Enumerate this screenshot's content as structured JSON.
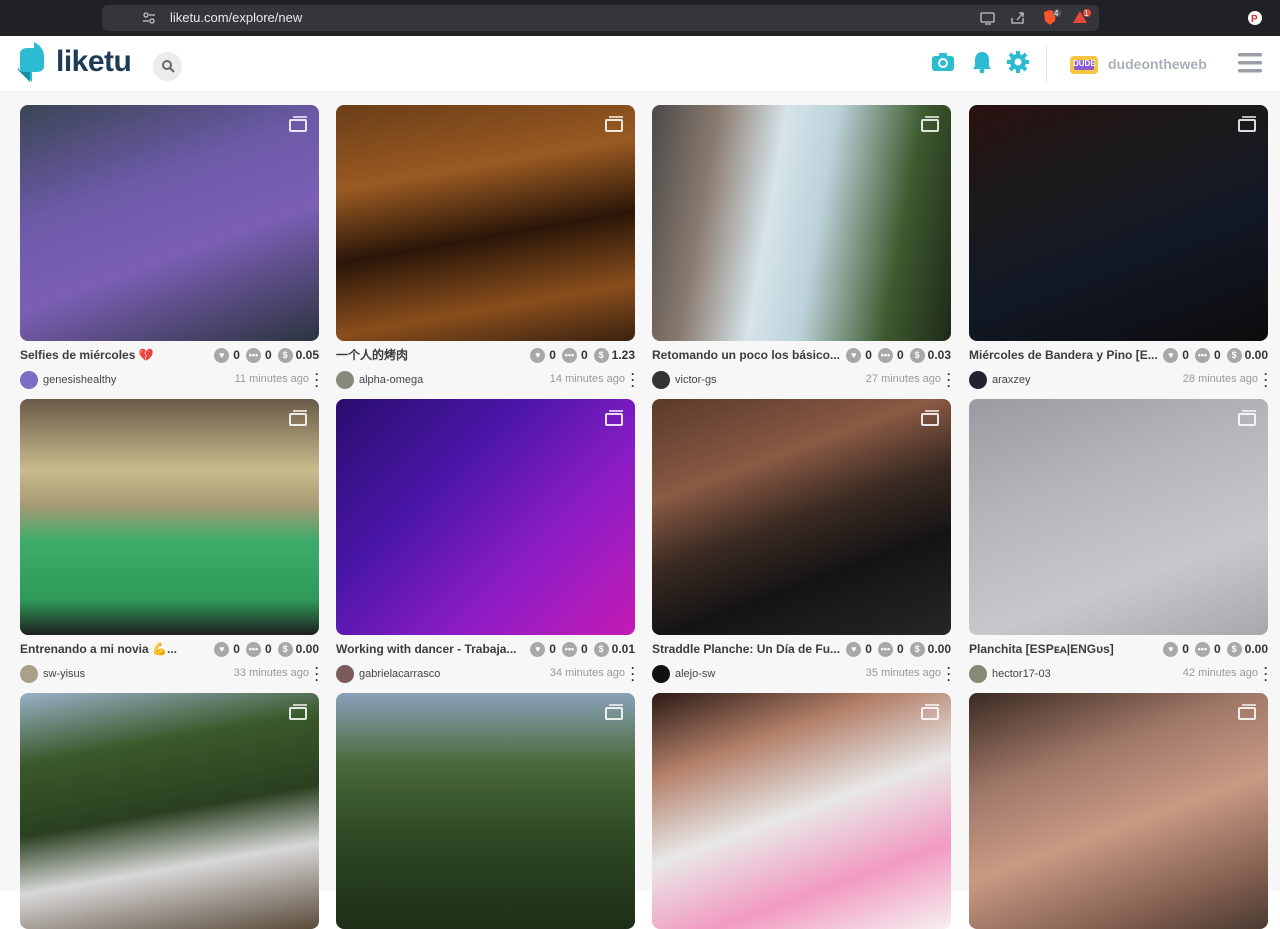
{
  "browser": {
    "url": "liketu.com/explore/new",
    "brave_count": "4",
    "alert_count": "1"
  },
  "header": {
    "logo_text": "liketu",
    "username": "dudeontheweb",
    "avatar_text": "DUDE"
  },
  "colors": {
    "accent": "#2bbcd4",
    "logo_dark": "#1f3b56"
  },
  "icons": [
    "bookmark-icon",
    "site-settings-icon",
    "cast-icon",
    "share-icon",
    "brave-shield-icon",
    "brave-rewards-icon",
    "extension-icon",
    "search-icon",
    "camera-icon",
    "bell-icon",
    "gear-icon",
    "hamburger-menu-icon",
    "gallery-icon",
    "heart-icon",
    "comment-icon",
    "dollar-icon",
    "more-options-icon"
  ],
  "posts": [
    {
      "title": "Selfies de miércoles 💔",
      "likes": "0",
      "comments": "0",
      "payout": "0.05",
      "author": "genesishealthy",
      "time": "11 minutes ago"
    },
    {
      "title": "一个人的烤肉",
      "likes": "0",
      "comments": "0",
      "payout": "1.23",
      "author": "alpha-omega",
      "time": "14 minutes ago"
    },
    {
      "title": "Retomando un poco los básico...",
      "likes": "0",
      "comments": "0",
      "payout": "0.03",
      "author": "victor-gs",
      "time": "27 minutes ago"
    },
    {
      "title": "Miércoles de Bandera y Pino [E...",
      "likes": "0",
      "comments": "0",
      "payout": "0.00",
      "author": "araxzey",
      "time": "28 minutes ago"
    },
    {
      "title": "Entrenando a mi novia 💪...",
      "likes": "0",
      "comments": "0",
      "payout": "0.00",
      "author": "sw-yisus",
      "time": "33 minutes ago"
    },
    {
      "title": "Working with dancer - Trabaja...",
      "likes": "0",
      "comments": "0",
      "payout": "0.01",
      "author": "gabrielacarrasco",
      "time": "34 minutes ago"
    },
    {
      "title": "Straddle Planche: Un Día de Fu...",
      "likes": "0",
      "comments": "0",
      "payout": "0.00",
      "author": "alejo-sw",
      "time": "35 minutes ago"
    },
    {
      "title": "Planchita [ESPᴇᴀ|ENGᴜs]",
      "likes": "0",
      "comments": "0",
      "payout": "0.00",
      "author": "hector17-03",
      "time": "42 minutes ago"
    },
    {
      "title": "",
      "likes": "",
      "comments": "",
      "payout": "",
      "author": "",
      "time": ""
    },
    {
      "title": "",
      "likes": "",
      "comments": "",
      "payout": "",
      "author": "",
      "time": ""
    },
    {
      "title": "",
      "likes": "",
      "comments": "",
      "payout": "",
      "author": "",
      "time": ""
    },
    {
      "title": "",
      "likes": "",
      "comments": "",
      "payout": "",
      "author": "",
      "time": ""
    }
  ]
}
